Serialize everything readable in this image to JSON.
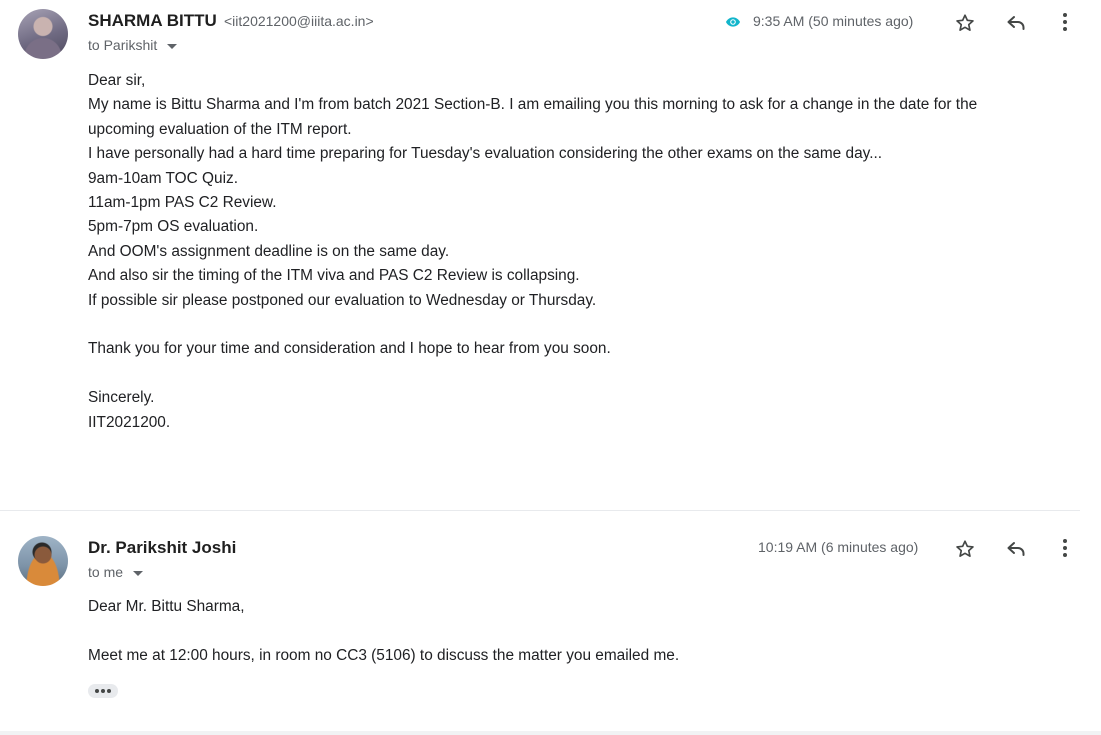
{
  "messages": [
    {
      "sender_name": "SHARMA BITTU",
      "sender_email": "<iit2021200@iiita.ac.in>",
      "to_label": "to Parikshit",
      "time": "9:35 AM (50 minutes ago)",
      "body_lines": [
        "Dear sir,",
        "My name is Bittu Sharma and I'm from batch 2021 Section-B. I am emailing you this morning to ask for a change in the date for the",
        "upcoming evaluation of the ITM report.",
        "I have personally had a hard time preparing for Tuesday's evaluation considering the other exams on the same day...",
        "9am-10am TOC Quiz.",
        "11am-1pm PAS C2 Review.",
        "5pm-7pm OS evaluation.",
        "And OOM's assignment deadline is on the same day.",
        "And also sir the timing of the ITM viva and PAS C2 Review is collapsing.",
        "If possible sir please postponed our evaluation to Wednesday or Thursday.",
        "",
        "Thank you for your time and consideration and I hope to hear from you soon.",
        "",
        "Sincerely.",
        "IIT2021200."
      ]
    },
    {
      "sender_name": "Dr. Parikshit Joshi",
      "to_label": "to me",
      "time": "10:19 AM (6 minutes ago)",
      "body_lines": [
        "Dear Mr. Bittu Sharma,",
        "",
        "Meet me at 12:00 hours, in room no CC3 (5106) to discuss the matter you emailed me."
      ]
    }
  ],
  "icons": {
    "read_indicator": "eye-icon",
    "star": "star-icon",
    "reply": "reply-icon",
    "more": "more-vert-icon",
    "show_trimmed": "ellipsis-icon"
  },
  "colors": {
    "read_indicator": "#12b5cb",
    "text": "#202124",
    "muted": "#5f6368"
  }
}
